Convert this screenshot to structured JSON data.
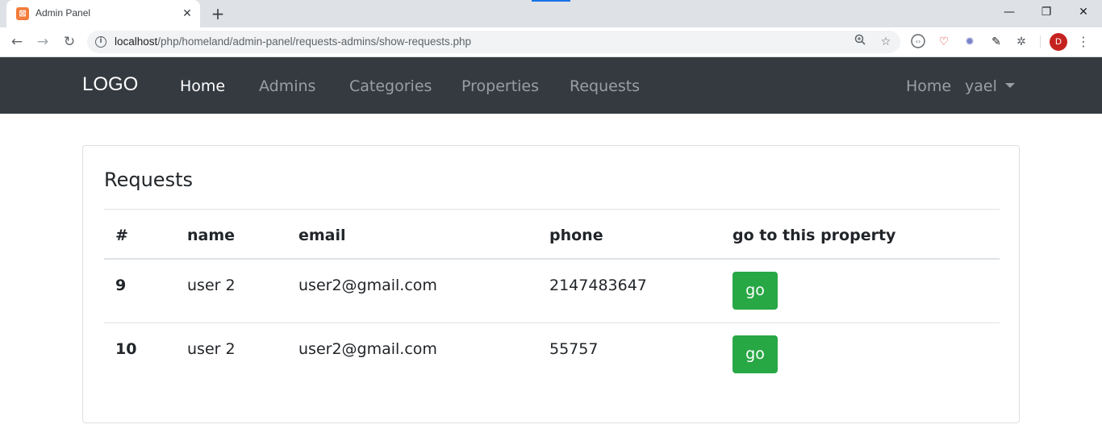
{
  "browser": {
    "tab_title": "Admin Panel",
    "tab_favicon": "⊠",
    "close_glyph": "✕",
    "new_tab_glyph": "+",
    "back_glyph": "←",
    "forward_glyph": "→",
    "reload_glyph": "↻",
    "url_host": "localhost",
    "url_path": "/php/homeland/admin-panel/requests-admins/show-requests.php",
    "profile_initial": "D",
    "minimize_glyph": "—",
    "restore_glyph": "❐",
    "window_close_glyph": "✕"
  },
  "navbar": {
    "brand": "LOGO",
    "links": [
      {
        "label": "Home"
      },
      {
        "label": "Admins"
      },
      {
        "label": "Categories"
      },
      {
        "label": "Properties"
      },
      {
        "label": "Requests"
      }
    ],
    "right_home": "Home",
    "user": "yael"
  },
  "card": {
    "title": "Requests",
    "headers": [
      "#",
      "name",
      "email",
      "phone",
      "go to this property"
    ],
    "rows": [
      {
        "id": "9",
        "name": "user 2",
        "email": "user2@gmail.com",
        "phone": "2147483647",
        "action": "go"
      },
      {
        "id": "10",
        "name": "user 2",
        "email": "user2@gmail.com",
        "phone": "55757",
        "action": "go"
      }
    ]
  },
  "colors": {
    "navbar_bg": "#343a40",
    "go_button": "#28a745",
    "tab_strip": "#dee1e6"
  }
}
